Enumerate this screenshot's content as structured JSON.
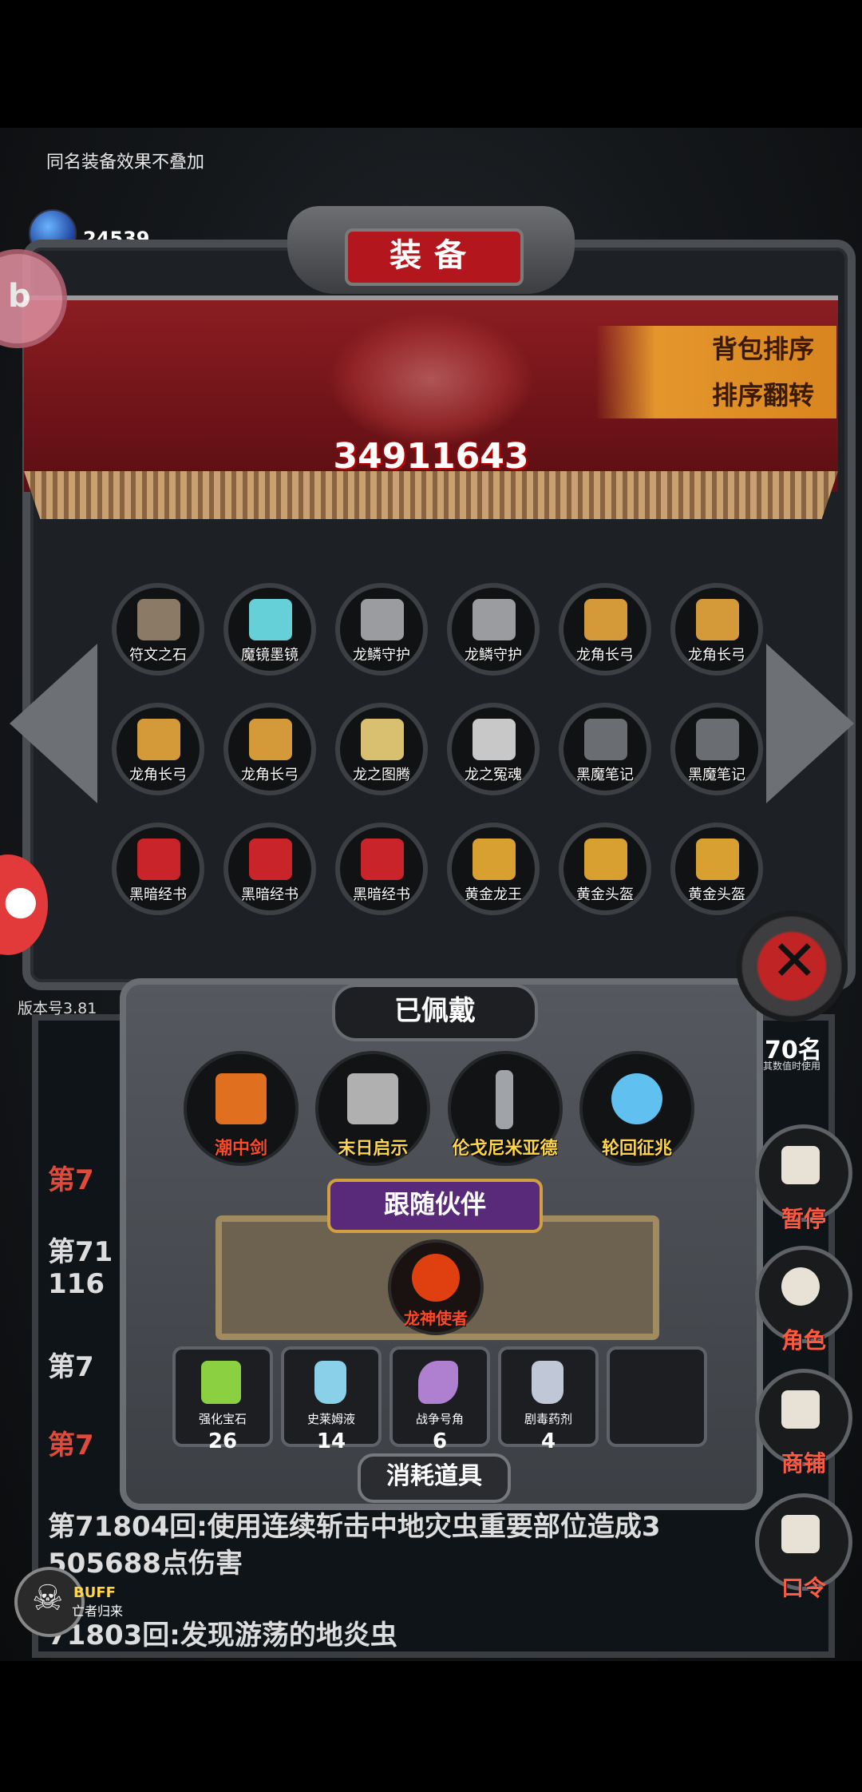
{
  "tip": "同名装备效果不叠加",
  "gem": {
    "label": "宝石",
    "count": "24539"
  },
  "header": {
    "title": "装备",
    "sort_label": "背包排序",
    "reverse_label": "排序翻转",
    "power": "34911643"
  },
  "equipment": [
    {
      "label": "符文之石",
      "color": "#8a7a66"
    },
    {
      "label": "魔镜墨镜",
      "color": "#66d0d8"
    },
    {
      "label": "龙鳞守护",
      "color": "#9a9ca0"
    },
    {
      "label": "龙鳞守护",
      "color": "#9a9ca0"
    },
    {
      "label": "龙角长弓",
      "color": "#d49a3a"
    },
    {
      "label": "龙角长弓",
      "color": "#d49a3a"
    },
    {
      "label": "龙角长弓",
      "color": "#d49a3a"
    },
    {
      "label": "龙角长弓",
      "color": "#d49a3a"
    },
    {
      "label": "龙之图腾",
      "color": "#d8c070"
    },
    {
      "label": "龙之冤魂",
      "color": "#c8c8c8"
    },
    {
      "label": "黑魔笔记",
      "color": "#6a6d72"
    },
    {
      "label": "黑魔笔记",
      "color": "#6a6d72"
    },
    {
      "label": "黑暗经书",
      "color": "#c8242a"
    },
    {
      "label": "黑暗经书",
      "color": "#c8242a"
    },
    {
      "label": "黑暗经书",
      "color": "#c8242a"
    },
    {
      "label": "黄金龙王",
      "color": "#d8a030"
    },
    {
      "label": "黄金头盔",
      "color": "#d8a030"
    },
    {
      "label": "黄金头盔",
      "color": "#d8a030"
    }
  ],
  "version": "版本号3.81",
  "counter": {
    "value": "70名",
    "note": "其数值时使用"
  },
  "worn": {
    "title": "已佩戴",
    "items": [
      {
        "label": "潮中剑",
        "color": "#e07020",
        "highlight": true
      },
      {
        "label": "末日启示",
        "color": "#b0b0b0",
        "highlight": false
      },
      {
        "label": "伦戈尼米亚德",
        "color": "#a0a4a8",
        "highlight": false
      },
      {
        "label": "轮回征兆",
        "color": "#60c0f0",
        "highlight": false
      }
    ]
  },
  "partner": {
    "title": "跟随伙伴",
    "name": "龙神使者",
    "color": "#e04010"
  },
  "consumables": {
    "title": "消耗道具",
    "items": [
      {
        "label": "强化宝石",
        "count": "26",
        "color": "#8ad040"
      },
      {
        "label": "史莱姆液",
        "count": "14",
        "color": "#8ad0e8"
      },
      {
        "label": "战争号角",
        "count": "6",
        "color": "#b080d0"
      },
      {
        "label": "剧毒药剂",
        "count": "4",
        "color": "#c0c8d8"
      },
      {
        "label": "",
        "count": "",
        "color": "#1c1e21"
      }
    ]
  },
  "log": [
    "第7",
    "第71",
    "116",
    "第7",
    "第7",
    "第71804回:使用连续斩击中地灾虫重要部位造成3",
    "505688点伤害",
    "71803回:发现游荡的地炎虫"
  ],
  "side_buttons": [
    {
      "label": "暂停",
      "icon": "dice-icon"
    },
    {
      "label": "角色",
      "icon": "character-icon"
    },
    {
      "label": "商铺",
      "icon": "shop-icon"
    },
    {
      "label": "口令",
      "icon": "code-book-icon"
    }
  ],
  "buff": {
    "title": "BUFF",
    "subtitle": "亡者归来"
  }
}
